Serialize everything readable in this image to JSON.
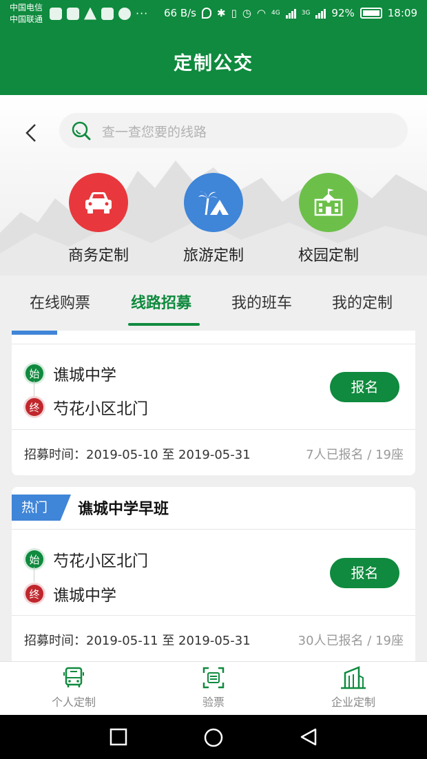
{
  "status_bar": {
    "carrier_1": "中国电信",
    "carrier_2": "中国联通",
    "more": "···",
    "speed": "66 B/s",
    "net_4g": "4G",
    "net_3g": "3G",
    "battery": "92%",
    "time": "18:09"
  },
  "header": {
    "title": "定制公交"
  },
  "search": {
    "placeholder": "查一查您要的线路"
  },
  "categories": [
    {
      "label": "商务定制",
      "icon": "car-icon",
      "color": "#e8383d"
    },
    {
      "label": "旅游定制",
      "icon": "palm-mountain-icon",
      "color": "#3f85d8"
    },
    {
      "label": "校园定制",
      "icon": "school-icon",
      "color": "#6cc04a"
    }
  ],
  "tabs": [
    {
      "label": "在线购票",
      "active": false
    },
    {
      "label": "线路招募",
      "active": true
    },
    {
      "label": "我的班车",
      "active": false
    },
    {
      "label": "我的定制",
      "active": false
    }
  ],
  "routes": [
    {
      "start_badge": "始",
      "start": "谯城中学",
      "end_badge": "终",
      "end": "芍花小区北门",
      "button": "报名",
      "period": "招募时间：2019-05-10 至 2019-05-31",
      "count": "7人已报名 / 19座"
    },
    {
      "badge": "热门",
      "title": "谯城中学早班",
      "start_badge": "始",
      "start": "芍花小区北门",
      "end_badge": "终",
      "end": "谯城中学",
      "button": "报名",
      "period": "招募时间：2019-05-11 至 2019-05-31",
      "count": "30人已报名 / 19座"
    }
  ],
  "bottom_nav": [
    {
      "label": "个人定制",
      "icon": "bus-icon",
      "active": true
    },
    {
      "label": "验票",
      "icon": "scan-ticket-icon",
      "active": false
    },
    {
      "label": "企业定制",
      "icon": "building-icon",
      "active": false
    }
  ],
  "colors": {
    "brand_green": "#0f8a3e",
    "hot_blue": "#3f85d8",
    "end_red": "#c0272d"
  }
}
